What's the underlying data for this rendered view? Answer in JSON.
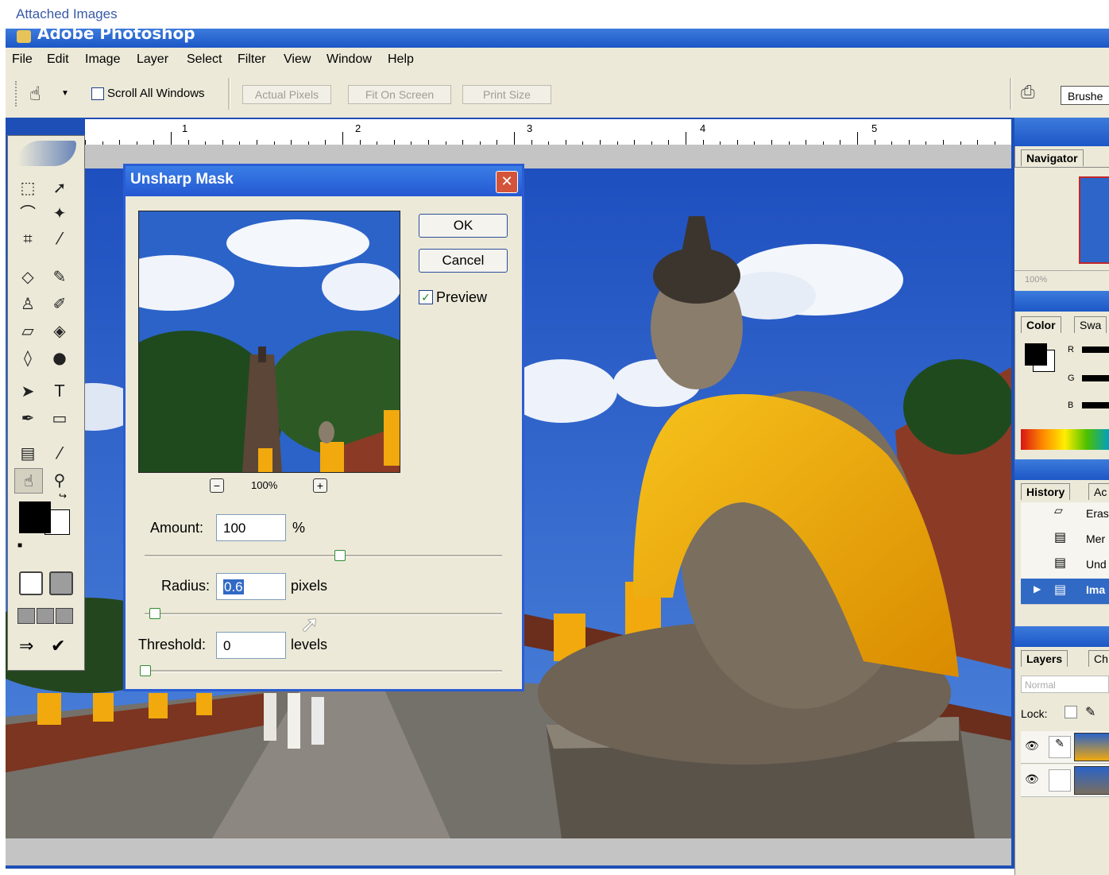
{
  "forum": {
    "caption": "Attached Images"
  },
  "window": {
    "title": "Adobe Photoshop"
  },
  "menu": [
    "File",
    "Edit",
    "Image",
    "Layer",
    "Select",
    "Filter",
    "View",
    "Window",
    "Help"
  ],
  "options": {
    "scroll_all_label": "Scroll All Windows",
    "actual_pixels": "Actual Pixels",
    "fit_on_screen": "Fit On Screen",
    "print_size": "Print Size",
    "brushes_tab": "Brushe"
  },
  "ruler": {
    "marks": [
      "1",
      "2",
      "3",
      "4",
      "5"
    ]
  },
  "dialog": {
    "title": "Unsharp Mask",
    "close": "✕",
    "ok": "OK",
    "cancel": "Cancel",
    "preview_label": "Preview",
    "preview_checked": true,
    "zoom": "100%",
    "zoom_out": "−",
    "zoom_in": "+",
    "amount": {
      "label": "Amount:",
      "value": "100",
      "unit": "%"
    },
    "radius": {
      "label": "Radius:",
      "value": "0.6",
      "unit": "pixels"
    },
    "threshold": {
      "label": "Threshold:",
      "value": "0",
      "unit": "levels"
    }
  },
  "panels": {
    "navigator": {
      "tab": "Navigator",
      "zoom": "100%"
    },
    "color": {
      "tab": "Color",
      "tab2": "Swa",
      "channels": [
        "R",
        "G",
        "B"
      ]
    },
    "history": {
      "tab": "History",
      "tab2": "Ac",
      "items": [
        "Eras",
        "Mer",
        "Und",
        "Ima"
      ]
    },
    "layers": {
      "tab": "Layers",
      "tab2": "Ch",
      "blend_mode": "Normal",
      "lock_label": "Lock:"
    }
  },
  "colors": {
    "xp_blue": "#1e4fb6",
    "panel_bg": "#ece9d8",
    "robe": "#f1a90e",
    "sky": "#2b63c9"
  }
}
